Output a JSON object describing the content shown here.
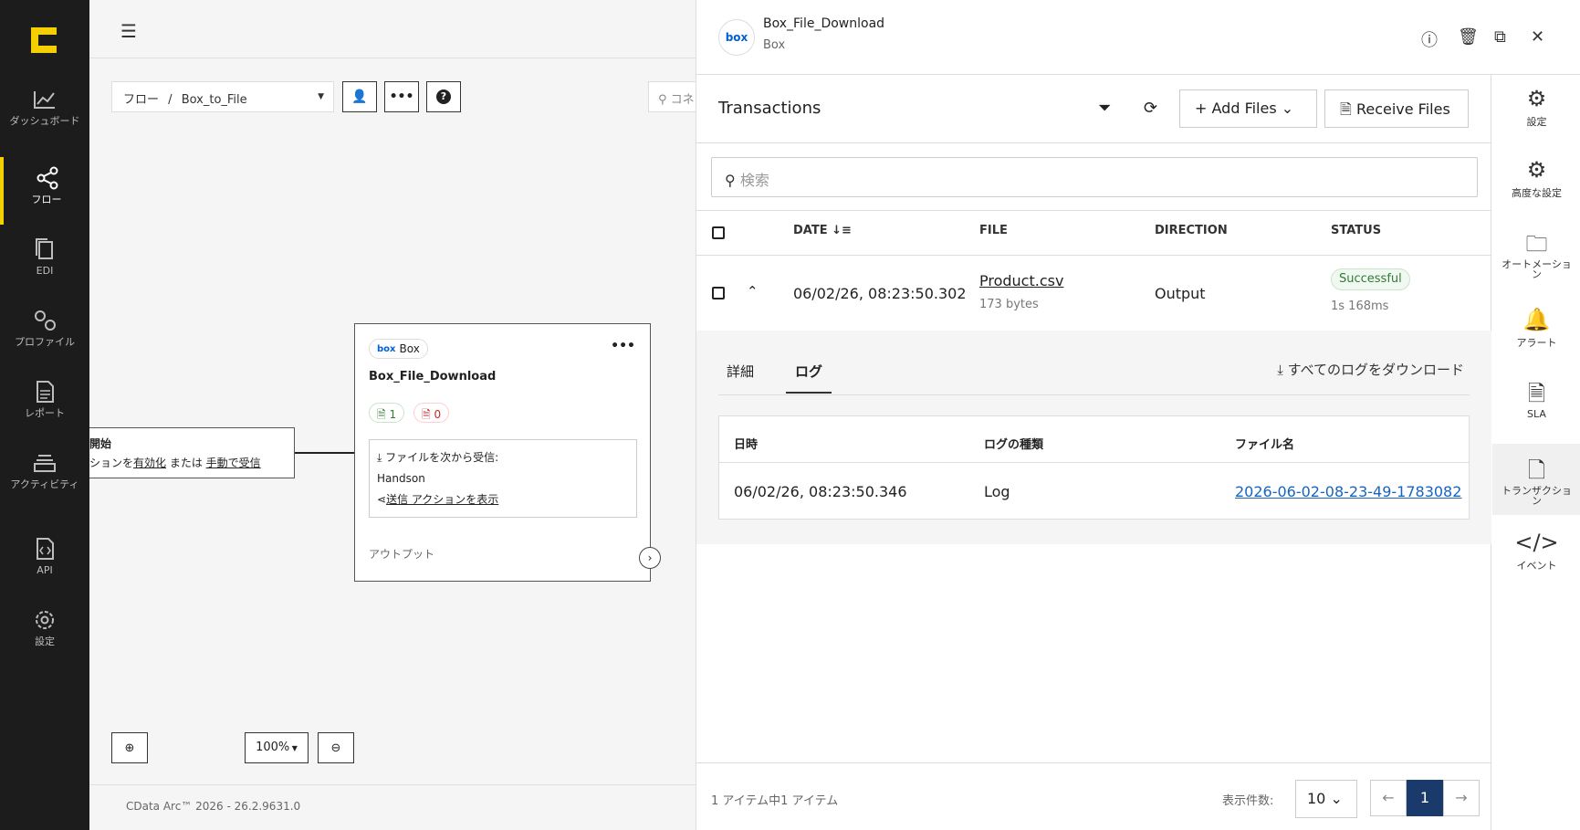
{
  "sidebar": {
    "items": [
      {
        "label": "ダッシュボード",
        "icon": "chart-line-icon"
      },
      {
        "label": "フロー",
        "icon": "share-nodes-icon"
      },
      {
        "label": "EDI",
        "icon": "copy-icon"
      },
      {
        "label": "プロファイル",
        "icon": "gears-icon"
      },
      {
        "label": "レポート",
        "icon": "file-text-icon"
      },
      {
        "label": "アクティビティ",
        "icon": "stack-icon"
      },
      {
        "label": "API",
        "icon": "file-code-icon"
      },
      {
        "label": "設定",
        "icon": "gear-icon"
      }
    ],
    "accent": "#f5d000"
  },
  "canvas": {
    "breadcrumb_root": "フロー",
    "breadcrumb_sep": "/",
    "breadcrumb_flow": "Box_to_File",
    "search_placeholder": "コネ",
    "start_node": {
      "title": "開始",
      "line_prefix": "ションを",
      "enable_link": "有効化",
      "or_text": " または ",
      "manual_link": "手動で受信"
    },
    "node": {
      "chip_label": "Box",
      "chip_logo": "box",
      "title": "Box_File_Download",
      "success_count": "1",
      "error_count": "0",
      "receive_label": "ファイルを次から受信:",
      "receive_from": "Handson",
      "action_link": "送信 アクションを表示",
      "output_label": "アウトプット"
    },
    "zoom_level": "100%",
    "footer": "CData Arc™ 2026 - 26.2.9631.0"
  },
  "panel": {
    "header": {
      "name": "Box_File_Download",
      "type": "Box",
      "logo": "box"
    },
    "title": "Transactions",
    "add_files": "Add Files",
    "receive_files": "Receive Files",
    "search_placeholder": "検索",
    "columns": {
      "date": "DATE",
      "file": "FILE",
      "direction": "DIRECTION",
      "status": "STATUS"
    },
    "row": {
      "date": "06/02/26, 08:23:50.302",
      "file": "Product.csv",
      "size": "173 bytes",
      "direction": "Output",
      "status": "Successful",
      "duration": "1s 168ms"
    },
    "detail": {
      "tab_details": "詳細",
      "tab_logs": "ログ",
      "download_all": "すべてのログをダウンロード",
      "log_columns": {
        "time": "日時",
        "type": "ログの種類",
        "filename": "ファイル名"
      },
      "log_row": {
        "time": "06/02/26, 08:23:50.346",
        "type": "Log",
        "filename": "2026-06-02-08-23-49-1783082"
      }
    },
    "footer": {
      "count": "1 アイテム中1 アイテム",
      "per_page_label": "表示件数:",
      "per_page": "10",
      "page": "1"
    },
    "right_nav": [
      {
        "label": "設定",
        "icon": "gear-icon"
      },
      {
        "label": "高度な設定",
        "icon": "gears-icon"
      },
      {
        "label": "オートメーション",
        "icon": "folder-gear-icon"
      },
      {
        "label": "アラート",
        "icon": "bell-icon"
      },
      {
        "label": "SLA",
        "icon": "file-chart-icon"
      },
      {
        "label": "トランザクション",
        "icon": "file-icon"
      },
      {
        "label": "イベント",
        "icon": "code-icon"
      }
    ]
  }
}
